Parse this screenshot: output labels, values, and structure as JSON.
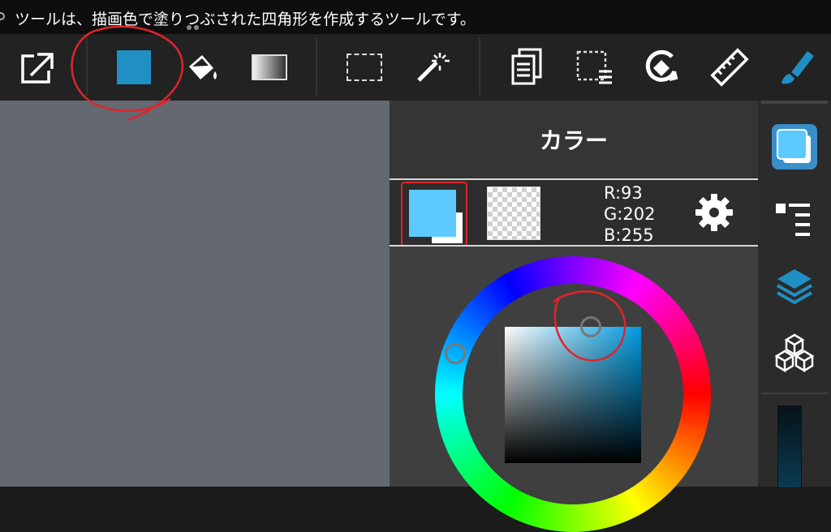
{
  "caption": {
    "text": "ツールは、描画色で塗りつぶされた四角形を作成するツールです。"
  },
  "toolbar": {
    "tools": [
      {
        "name": "export-icon"
      },
      {
        "name": "rectangle-fill-tool-icon",
        "color": "#1f8fc4"
      },
      {
        "name": "paint-bucket-icon"
      },
      {
        "name": "gradient-tool-icon"
      },
      {
        "name": "select-rectangle-icon"
      },
      {
        "name": "magic-wand-icon"
      },
      {
        "name": "layers-pages-icon"
      },
      {
        "name": "selection-menu-icon"
      },
      {
        "name": "rotate-transform-icon"
      },
      {
        "name": "ruler-icon"
      },
      {
        "name": "brush-pen-icon",
        "color": "#1f8fc4"
      }
    ]
  },
  "color_panel": {
    "title": "カラー",
    "foreground_color": "#5dcaff",
    "rgb": {
      "r": "R:93",
      "g": "G:202",
      "b": "B:255"
    },
    "settings_icon": "gear-icon"
  },
  "sidebar": {
    "items": [
      {
        "name": "color-panel-icon",
        "active": true
      },
      {
        "name": "brush-list-icon"
      },
      {
        "name": "layer-icon"
      },
      {
        "name": "material-cubes-icon"
      }
    ]
  },
  "colors": {
    "accent": "#1f8fc4",
    "annotation": "#e0252c",
    "selected_color": "#5dcaff"
  }
}
